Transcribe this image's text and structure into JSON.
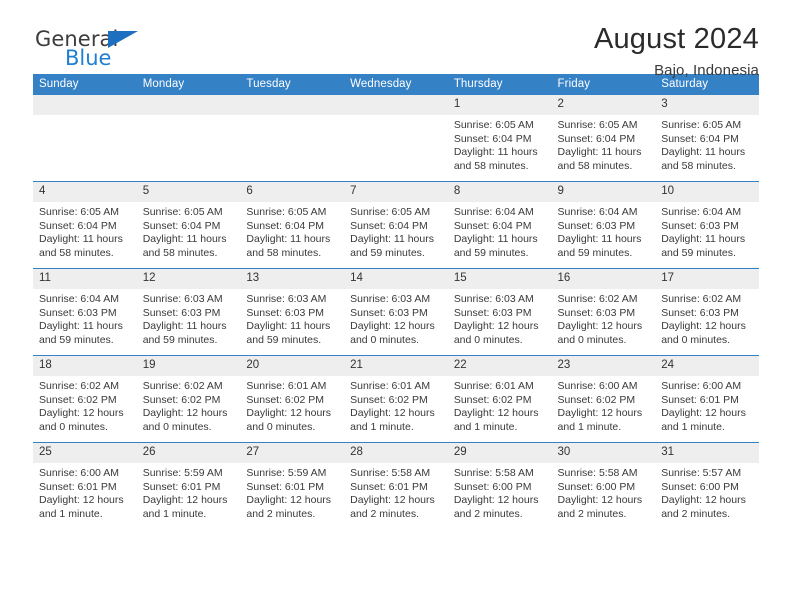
{
  "logo": {
    "word_top": "General",
    "word_bottom": "Blue",
    "triangle_color": "#1f6fc0",
    "blue_color": "#1f7fd0"
  },
  "header": {
    "title": "August 2024",
    "location": "Bajo, Indonesia"
  },
  "theme": {
    "header_blue": "#3581c6",
    "daynum_bg": "#eeeeee",
    "text": "#3a3a3a"
  },
  "weekdays": [
    "Sunday",
    "Monday",
    "Tuesday",
    "Wednesday",
    "Thursday",
    "Friday",
    "Saturday"
  ],
  "weeks": [
    [
      {
        "day": "",
        "lines": []
      },
      {
        "day": "",
        "lines": []
      },
      {
        "day": "",
        "lines": []
      },
      {
        "day": "",
        "lines": []
      },
      {
        "day": "1",
        "lines": [
          "Sunrise: 6:05 AM",
          "Sunset: 6:04 PM",
          "Daylight: 11 hours and 58 minutes."
        ]
      },
      {
        "day": "2",
        "lines": [
          "Sunrise: 6:05 AM",
          "Sunset: 6:04 PM",
          "Daylight: 11 hours and 58 minutes."
        ]
      },
      {
        "day": "3",
        "lines": [
          "Sunrise: 6:05 AM",
          "Sunset: 6:04 PM",
          "Daylight: 11 hours and 58 minutes."
        ]
      }
    ],
    [
      {
        "day": "4",
        "lines": [
          "Sunrise: 6:05 AM",
          "Sunset: 6:04 PM",
          "Daylight: 11 hours and 58 minutes."
        ]
      },
      {
        "day": "5",
        "lines": [
          "Sunrise: 6:05 AM",
          "Sunset: 6:04 PM",
          "Daylight: 11 hours and 58 minutes."
        ]
      },
      {
        "day": "6",
        "lines": [
          "Sunrise: 6:05 AM",
          "Sunset: 6:04 PM",
          "Daylight: 11 hours and 58 minutes."
        ]
      },
      {
        "day": "7",
        "lines": [
          "Sunrise: 6:05 AM",
          "Sunset: 6:04 PM",
          "Daylight: 11 hours and 59 minutes."
        ]
      },
      {
        "day": "8",
        "lines": [
          "Sunrise: 6:04 AM",
          "Sunset: 6:04 PM",
          "Daylight: 11 hours and 59 minutes."
        ]
      },
      {
        "day": "9",
        "lines": [
          "Sunrise: 6:04 AM",
          "Sunset: 6:03 PM",
          "Daylight: 11 hours and 59 minutes."
        ]
      },
      {
        "day": "10",
        "lines": [
          "Sunrise: 6:04 AM",
          "Sunset: 6:03 PM",
          "Daylight: 11 hours and 59 minutes."
        ]
      }
    ],
    [
      {
        "day": "11",
        "lines": [
          "Sunrise: 6:04 AM",
          "Sunset: 6:03 PM",
          "Daylight: 11 hours and 59 minutes."
        ]
      },
      {
        "day": "12",
        "lines": [
          "Sunrise: 6:03 AM",
          "Sunset: 6:03 PM",
          "Daylight: 11 hours and 59 minutes."
        ]
      },
      {
        "day": "13",
        "lines": [
          "Sunrise: 6:03 AM",
          "Sunset: 6:03 PM",
          "Daylight: 11 hours and 59 minutes."
        ]
      },
      {
        "day": "14",
        "lines": [
          "Sunrise: 6:03 AM",
          "Sunset: 6:03 PM",
          "Daylight: 12 hours and 0 minutes."
        ]
      },
      {
        "day": "15",
        "lines": [
          "Sunrise: 6:03 AM",
          "Sunset: 6:03 PM",
          "Daylight: 12 hours and 0 minutes."
        ]
      },
      {
        "day": "16",
        "lines": [
          "Sunrise: 6:02 AM",
          "Sunset: 6:03 PM",
          "Daylight: 12 hours and 0 minutes."
        ]
      },
      {
        "day": "17",
        "lines": [
          "Sunrise: 6:02 AM",
          "Sunset: 6:03 PM",
          "Daylight: 12 hours and 0 minutes."
        ]
      }
    ],
    [
      {
        "day": "18",
        "lines": [
          "Sunrise: 6:02 AM",
          "Sunset: 6:02 PM",
          "Daylight: 12 hours and 0 minutes."
        ]
      },
      {
        "day": "19",
        "lines": [
          "Sunrise: 6:02 AM",
          "Sunset: 6:02 PM",
          "Daylight: 12 hours and 0 minutes."
        ]
      },
      {
        "day": "20",
        "lines": [
          "Sunrise: 6:01 AM",
          "Sunset: 6:02 PM",
          "Daylight: 12 hours and 0 minutes."
        ]
      },
      {
        "day": "21",
        "lines": [
          "Sunrise: 6:01 AM",
          "Sunset: 6:02 PM",
          "Daylight: 12 hours and 1 minute."
        ]
      },
      {
        "day": "22",
        "lines": [
          "Sunrise: 6:01 AM",
          "Sunset: 6:02 PM",
          "Daylight: 12 hours and 1 minute."
        ]
      },
      {
        "day": "23",
        "lines": [
          "Sunrise: 6:00 AM",
          "Sunset: 6:02 PM",
          "Daylight: 12 hours and 1 minute."
        ]
      },
      {
        "day": "24",
        "lines": [
          "Sunrise: 6:00 AM",
          "Sunset: 6:01 PM",
          "Daylight: 12 hours and 1 minute."
        ]
      }
    ],
    [
      {
        "day": "25",
        "lines": [
          "Sunrise: 6:00 AM",
          "Sunset: 6:01 PM",
          "Daylight: 12 hours and 1 minute."
        ]
      },
      {
        "day": "26",
        "lines": [
          "Sunrise: 5:59 AM",
          "Sunset: 6:01 PM",
          "Daylight: 12 hours and 1 minute."
        ]
      },
      {
        "day": "27",
        "lines": [
          "Sunrise: 5:59 AM",
          "Sunset: 6:01 PM",
          "Daylight: 12 hours and 2 minutes."
        ]
      },
      {
        "day": "28",
        "lines": [
          "Sunrise: 5:58 AM",
          "Sunset: 6:01 PM",
          "Daylight: 12 hours and 2 minutes."
        ]
      },
      {
        "day": "29",
        "lines": [
          "Sunrise: 5:58 AM",
          "Sunset: 6:00 PM",
          "Daylight: 12 hours and 2 minutes."
        ]
      },
      {
        "day": "30",
        "lines": [
          "Sunrise: 5:58 AM",
          "Sunset: 6:00 PM",
          "Daylight: 12 hours and 2 minutes."
        ]
      },
      {
        "day": "31",
        "lines": [
          "Sunrise: 5:57 AM",
          "Sunset: 6:00 PM",
          "Daylight: 12 hours and 2 minutes."
        ]
      }
    ]
  ]
}
